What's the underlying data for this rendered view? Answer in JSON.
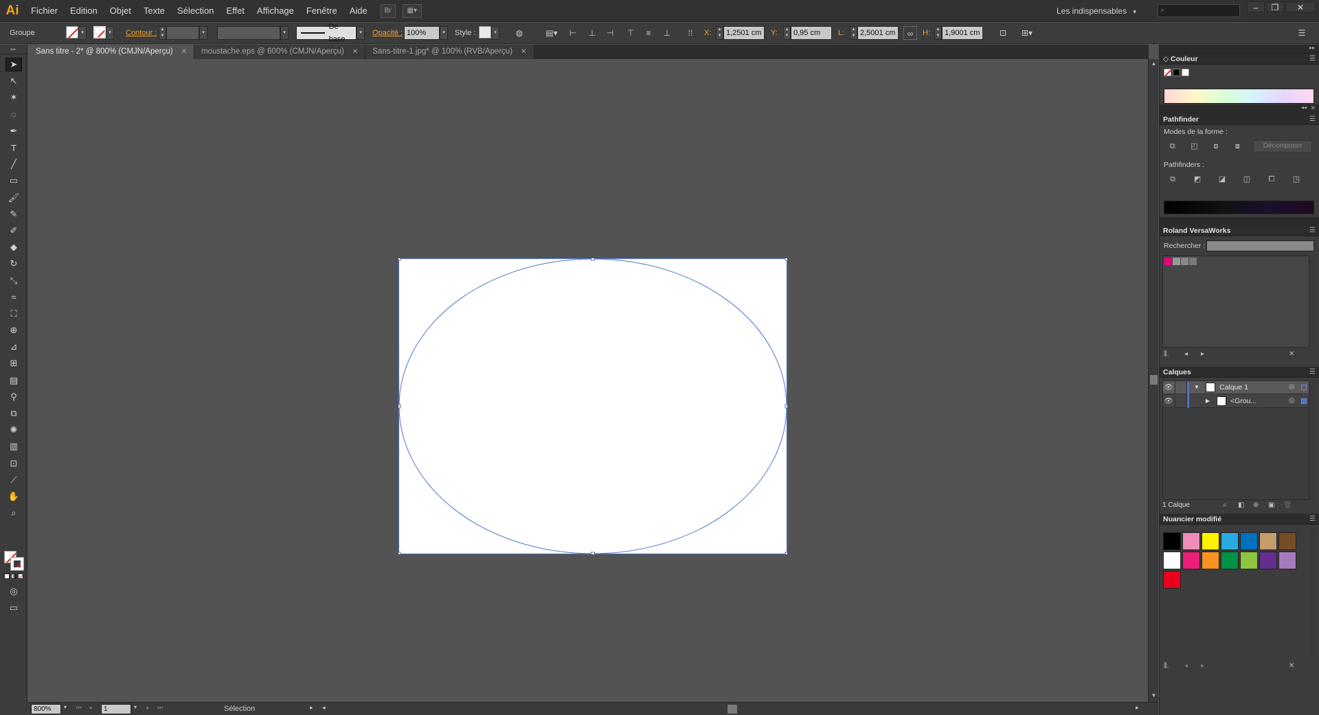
{
  "app": {
    "logo": "Ai"
  },
  "menu": [
    "Fichier",
    "Edition",
    "Objet",
    "Texte",
    "Sélection",
    "Effet",
    "Affichage",
    "Fenêtre",
    "Aide"
  ],
  "workspace": {
    "label": "Les indispensables",
    "arrow": "▾"
  },
  "control_bar": {
    "selection_type": "Groupe",
    "contour_label": "Contour :",
    "stroke_style": "De base",
    "opacity_label": "Opacité :",
    "opacity_value": "100%",
    "style_label": "Style :",
    "x_label": "X:",
    "x_value": "1,2501 cm",
    "y_label": "Y:",
    "y_value": "0,95 cm",
    "w_label": "L:",
    "w_value": "2,5001 cm",
    "h_label": "H:",
    "h_value": "1,9001 cm"
  },
  "tabs": [
    {
      "label": "Sans titre - 2* @ 800% (CMJN/Aperçu)",
      "active": true
    },
    {
      "label": "moustache.eps @ 600% (CMJN/Aperçu)",
      "active": false
    },
    {
      "label": "Sans-titre-1.jpg* @ 100% (RVB/Aperçu)",
      "active": false
    }
  ],
  "tools": [
    "selection-tool",
    "direct-selection-tool",
    "magic-wand-tool",
    "lasso-tool",
    "pen-tool",
    "type-tool",
    "line-tool",
    "rectangle-tool",
    "paintbrush-tool",
    "pencil-tool",
    "blob-brush-tool",
    "eraser-tool",
    "rotate-tool",
    "scale-tool",
    "warp-tool",
    "free-transform-tool",
    "shape-builder-tool",
    "perspective-grid-tool",
    "mesh-tool",
    "gradient-tool",
    "eyedropper-tool",
    "blend-tool",
    "symbol-sprayer-tool",
    "column-graph-tool",
    "artboard-tool",
    "slice-tool",
    "hand-tool",
    "zoom-tool"
  ],
  "status": {
    "zoom": "800%",
    "page": "1",
    "tool_label": "Sélection"
  },
  "panels": {
    "couleur": {
      "title": "Couleur"
    },
    "pathfinder": {
      "title": "Pathfinder",
      "modes_label": "Modes de la forme :",
      "decompose": "Décomposer",
      "pathfinders_label": "Pathfinders :"
    },
    "roland": {
      "title": "Roland VersaWorks",
      "search_label": "Rechercher :"
    },
    "calques": {
      "title": "Calques",
      "layers": [
        {
          "name": "Calque 1",
          "expanded": true
        },
        {
          "name": "<Grou...",
          "expanded": false
        }
      ],
      "count": "1 Calque"
    },
    "nuancier": {
      "title": "Nuancier modifié",
      "swatches": [
        "#000000",
        "#f08cb8",
        "#fff200",
        "#29abe2",
        "#0071bc",
        "#c69c6d",
        "#754c24",
        "#ffffff",
        "#ed1e79",
        "#f7931e",
        "#009245",
        "#8cc63f",
        "#662d91",
        "#a67cbf",
        "#e8001c"
      ]
    }
  }
}
